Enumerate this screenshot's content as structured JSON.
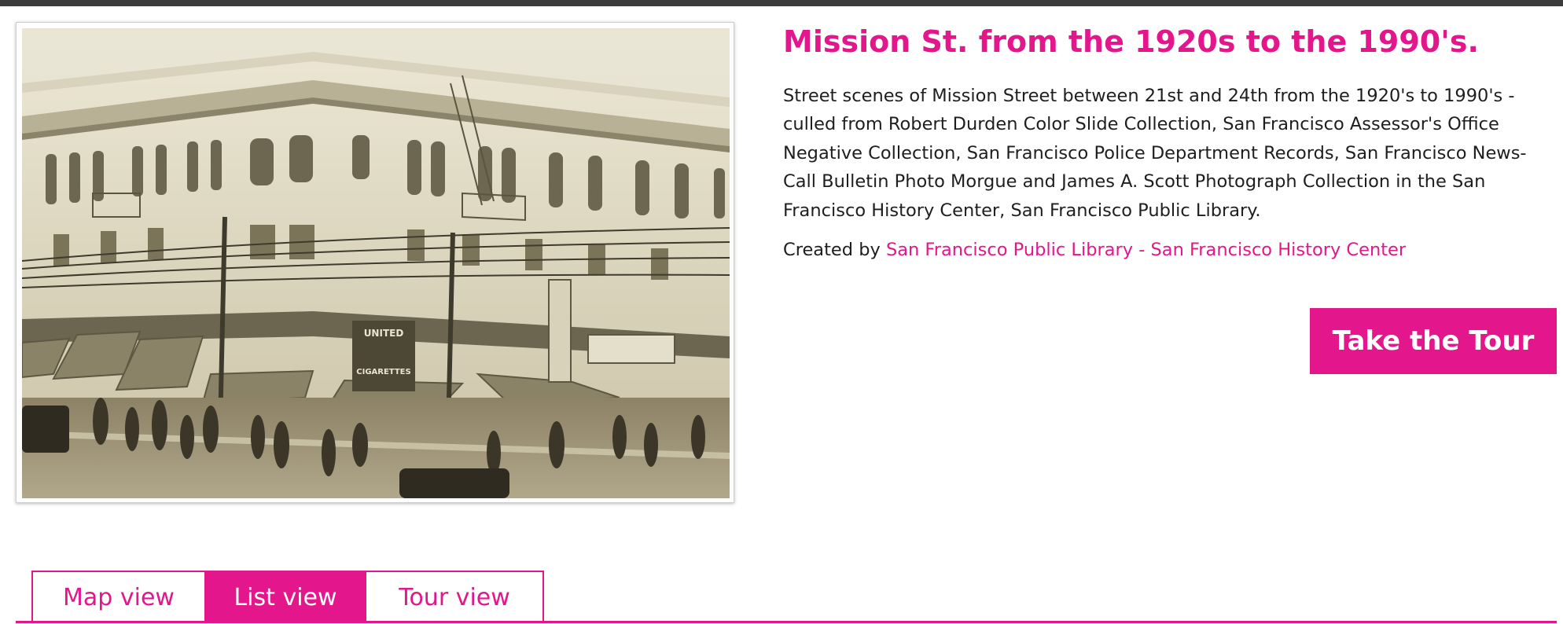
{
  "tour": {
    "title": "Mission St. from the 1920s to the 1990's.",
    "description": "Street scenes of Mission Street between 21st and 24th from the 1920's to 1990's - culled from Robert Durden Color Slide Collection, San Francisco Assessor's Office Negative Collection, San Francisco Police Department Records, San Francisco News-Call Bulletin Photo Morgue and James A. Scott Photograph Collection in the San Francisco History Center, San Francisco Public Library.",
    "created_by_label": "Created by",
    "creator": "San Francisco Public Library - San Francisco History Center",
    "cta_label": "Take the Tour"
  },
  "photo": {
    "signs": [
      "UNITED",
      "CIGARETTES"
    ]
  },
  "tabs": [
    {
      "label": "Map view",
      "active": false
    },
    {
      "label": "List view",
      "active": true
    },
    {
      "label": "Tour view",
      "active": false
    }
  ],
  "colors": {
    "accent": "#e4168c",
    "top_bar": "#3c3c3c",
    "text": "#1e1e1e"
  }
}
